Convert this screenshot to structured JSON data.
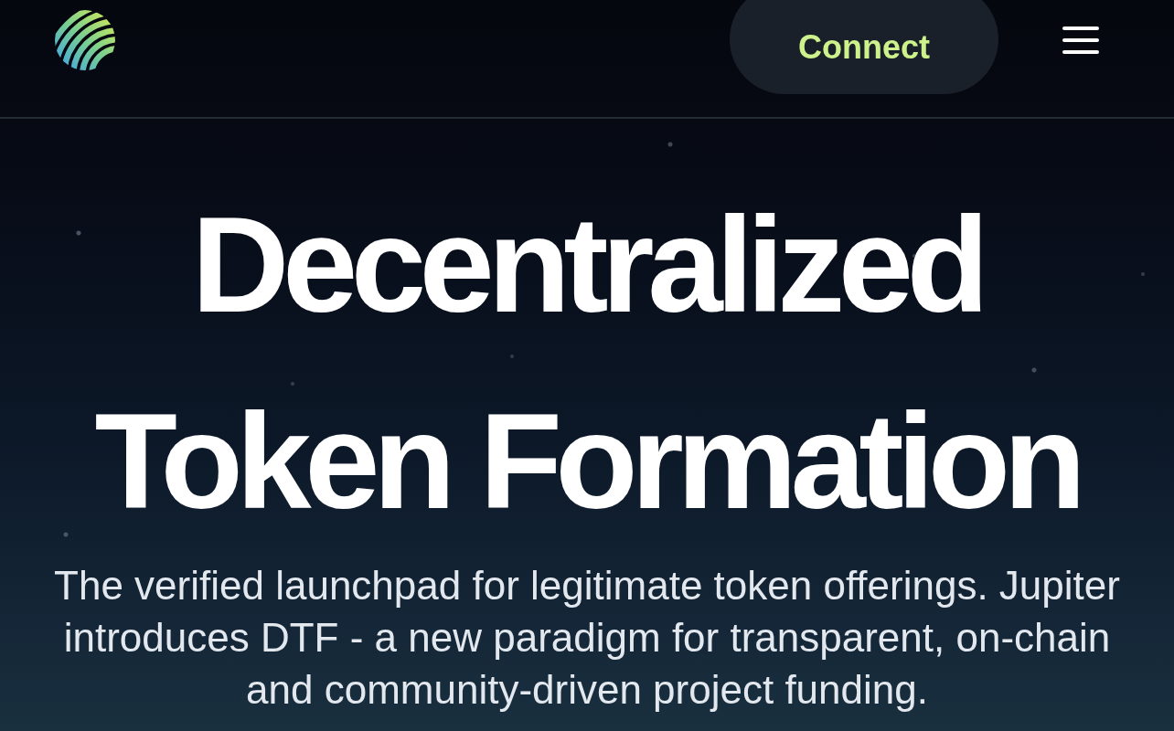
{
  "header": {
    "connect_button": "Connect"
  },
  "hero": {
    "title": "Decentralized Token Formation",
    "description": "The verified launchpad for legitimate token offerings. Jupiter introduces DTF - a new paradigm for transparent, on-chain and community-driven project funding."
  }
}
